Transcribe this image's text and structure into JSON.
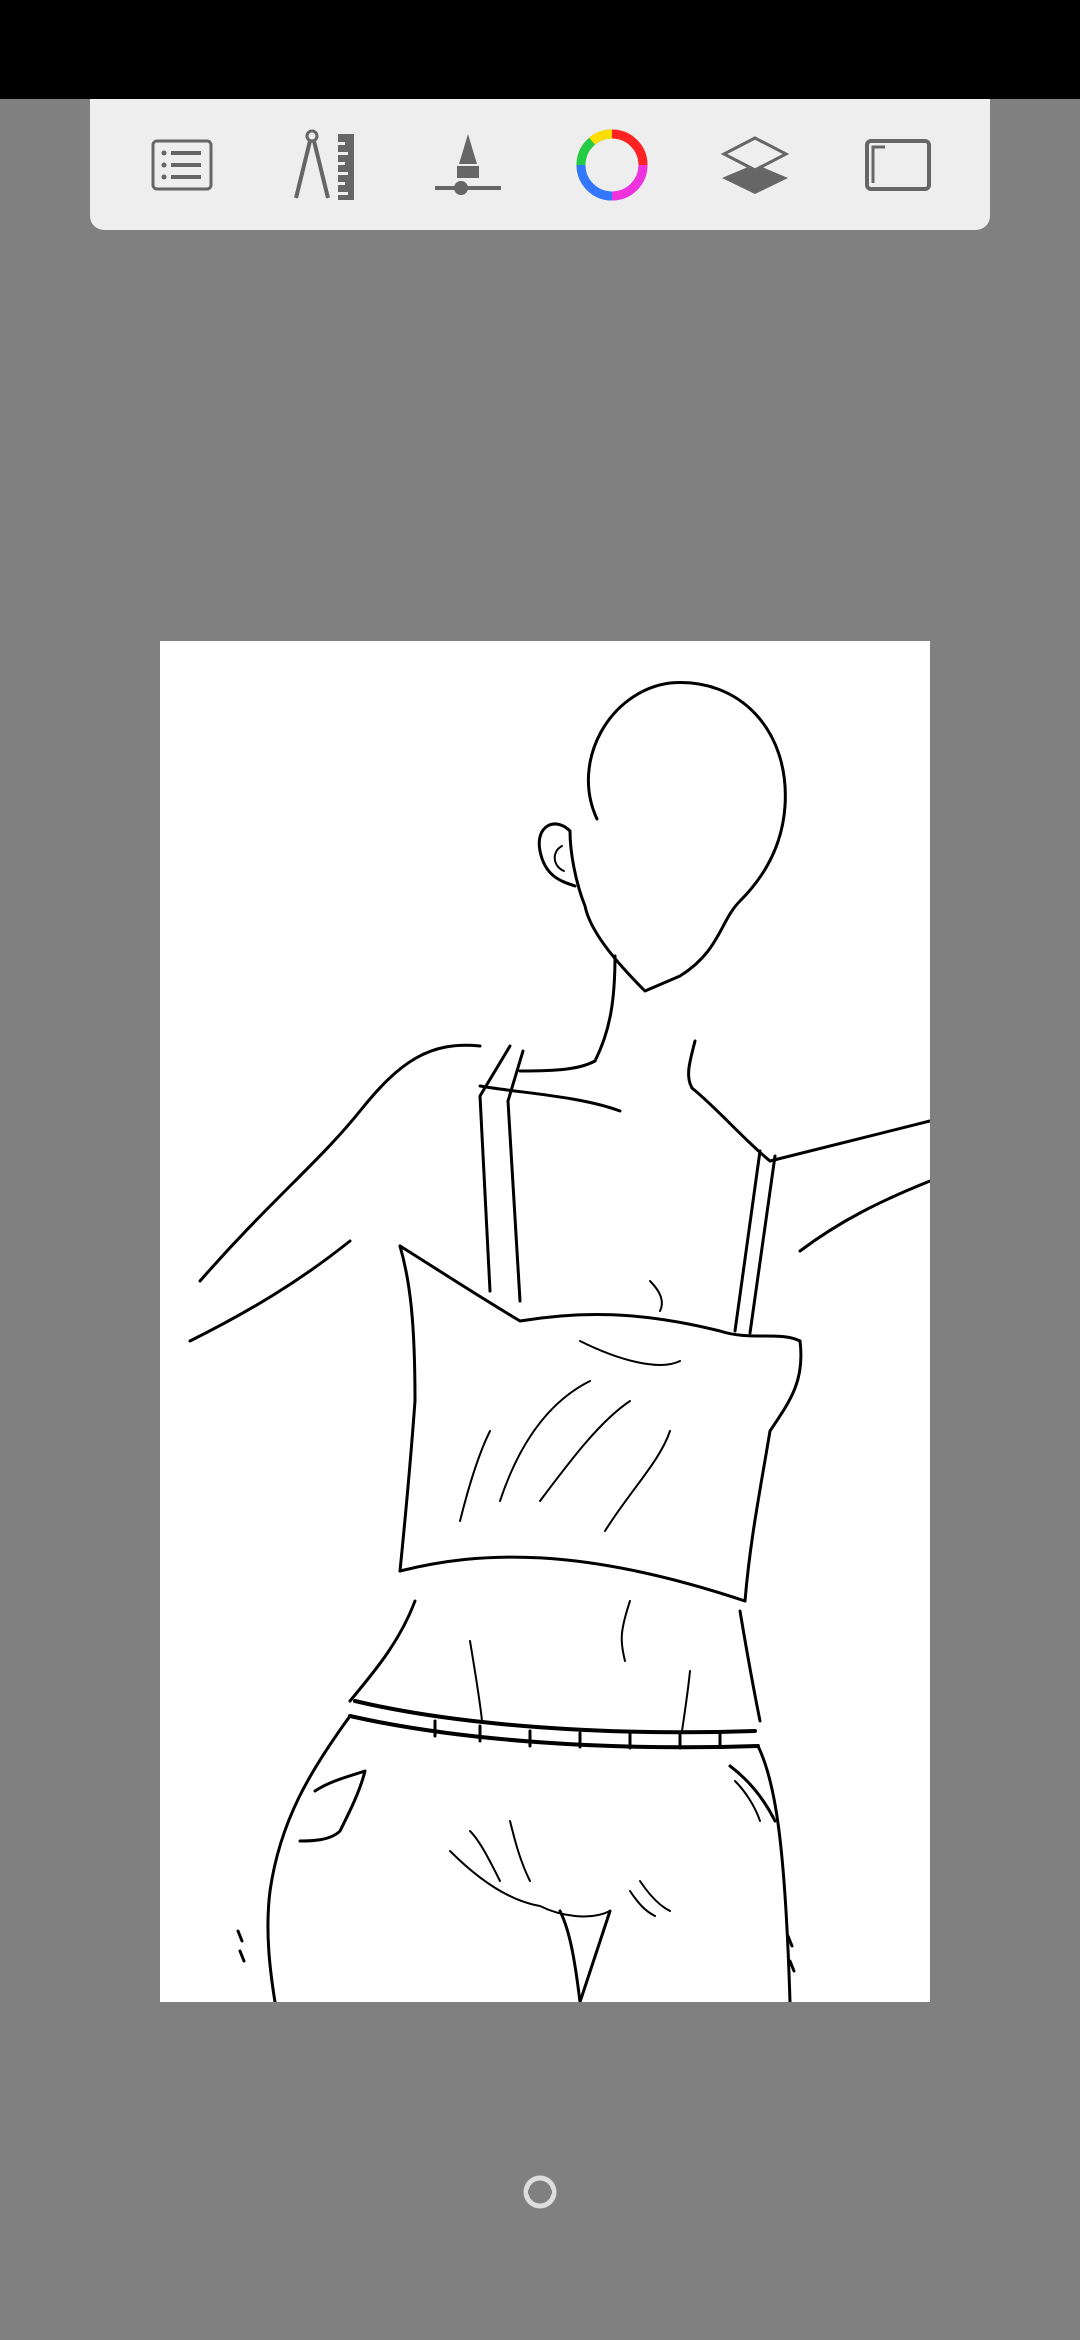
{
  "app": {
    "colors": {
      "status_bar": "#000000",
      "workspace": "#808080",
      "toolbar": "#eeeeee",
      "icon": "#666666",
      "canvas": "#ffffff"
    }
  },
  "toolbar": {
    "buttons": [
      {
        "icon": "list-icon",
        "name": "brush-list-button"
      },
      {
        "icon": "compass-ruler-icon",
        "name": "guides-button"
      },
      {
        "icon": "brush-size-icon",
        "name": "brush-properties-button"
      },
      {
        "icon": "color-wheel-icon",
        "name": "color-button"
      },
      {
        "icon": "layers-icon",
        "name": "layers-button"
      },
      {
        "icon": "fullscreen-icon",
        "name": "fullscreen-button"
      }
    ]
  },
  "canvas": {
    "content": "line-art-drawing"
  },
  "rotate_handle": {
    "icon": "rotate-reset-icon"
  }
}
